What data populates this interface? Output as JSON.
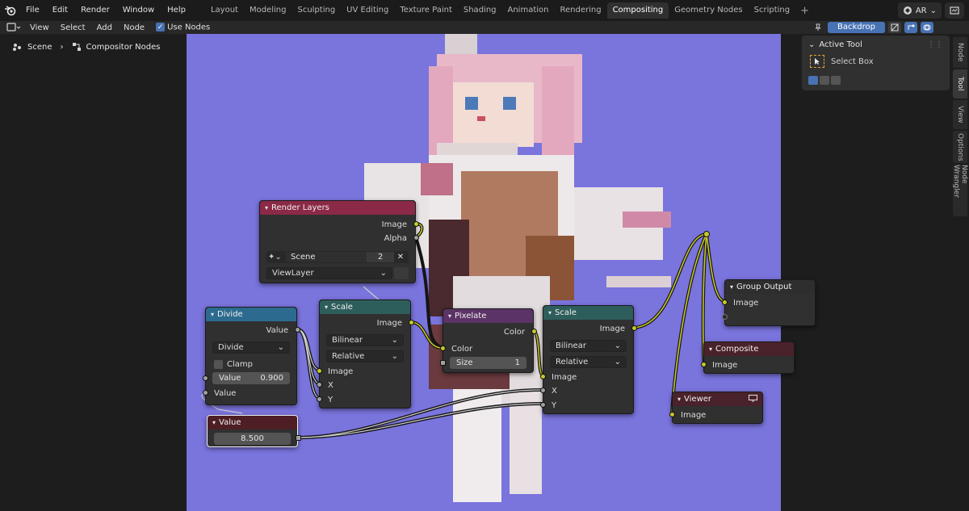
{
  "menu": [
    "File",
    "Edit",
    "Render",
    "Window",
    "Help"
  ],
  "workspaces": [
    {
      "label": "Layout",
      "active": false
    },
    {
      "label": "Modeling",
      "active": false
    },
    {
      "label": "Sculpting",
      "active": false
    },
    {
      "label": "UV Editing",
      "active": false
    },
    {
      "label": "Texture Paint",
      "active": false
    },
    {
      "label": "Shading",
      "active": false
    },
    {
      "label": "Animation",
      "active": false
    },
    {
      "label": "Rendering",
      "active": false
    },
    {
      "label": "Compositing",
      "active": true
    },
    {
      "label": "Geometry Nodes",
      "active": false
    },
    {
      "label": "Scripting",
      "active": false
    }
  ],
  "top_right": {
    "scene_chip": "AR",
    "plus": "+"
  },
  "header": {
    "view": "View",
    "select": "Select",
    "add": "Add",
    "node": "Node",
    "use_nodes": "Use Nodes",
    "backdrop": "Backdrop"
  },
  "breadcrumb": {
    "scene": "Scene",
    "tree": "Compositor Nodes"
  },
  "npanel": {
    "title": "Active Tool",
    "tool": "Select Box"
  },
  "side_tabs": [
    "Node",
    "Tool",
    "View",
    "Options",
    "Node Wrangler"
  ],
  "nodes": {
    "render_layers": {
      "title": "Render Layers",
      "out_image": "Image",
      "out_alpha": "Alpha",
      "scene": "Scene",
      "scene_users": "2",
      "view_layer": "ViewLayer"
    },
    "divide": {
      "title": "Divide",
      "out": "Value",
      "op": "Divide",
      "clamp": "Clamp",
      "value_label": "Value",
      "value": "0.900",
      "in": "Value"
    },
    "value": {
      "title": "Value",
      "value": "8.500"
    },
    "scale1": {
      "title": "Scale",
      "out": "Image",
      "filter": "Bilinear",
      "space": "Relative",
      "in_image": "Image",
      "in_x": "X",
      "in_y": "Y"
    },
    "pixelate": {
      "title": "Pixelate",
      "out": "Color",
      "in": "Color",
      "size_label": "Size",
      "size": "1"
    },
    "scale2": {
      "title": "Scale",
      "out": "Image",
      "filter": "Bilinear",
      "space": "Relative",
      "in_image": "Image",
      "in_x": "X",
      "in_y": "Y"
    },
    "group_output": {
      "title": "Group Output",
      "in": "Image"
    },
    "composite": {
      "title": "Composite",
      "in": "Image"
    },
    "viewer": {
      "title": "Viewer",
      "in": "Image"
    }
  },
  "colors": {
    "accent": "#4772b3",
    "backdrop": "#7a74dd",
    "socket_color": "#c7c729",
    "socket_value": "#a1a1a1"
  }
}
